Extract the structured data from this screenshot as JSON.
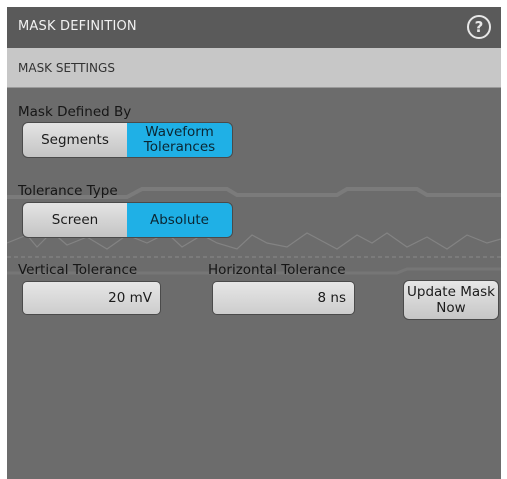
{
  "window": {
    "title": "MASK DEFINITION",
    "help_glyph": "?"
  },
  "section": {
    "title": "MASK SETTINGS"
  },
  "mask_defined_by": {
    "label": "Mask Defined By",
    "options": [
      {
        "label": "Segments",
        "selected": false
      },
      {
        "label": "Waveform Tolerances",
        "selected": true
      }
    ]
  },
  "tolerance_type": {
    "label": "Tolerance Type",
    "options": [
      {
        "label": "Screen",
        "selected": false
      },
      {
        "label": "Absolute",
        "selected": true
      }
    ]
  },
  "vertical_tolerance": {
    "label": "Vertical Tolerance",
    "value": "20 mV"
  },
  "horizontal_tolerance": {
    "label": "Horizontal Tolerance",
    "value": "8 ns"
  },
  "update_button": {
    "label": "Update Mask Now"
  },
  "colors": {
    "accent": "#1fb0e6",
    "panel": "#6c6c6c",
    "titlebar": "#5a5a5a",
    "section_bar": "#c7c7c7"
  },
  "icons": {
    "help": "question-circle-icon"
  }
}
